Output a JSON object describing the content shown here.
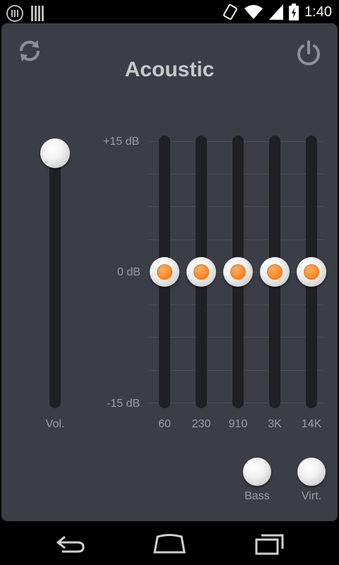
{
  "status_bar": {
    "time": "1:40"
  },
  "header": {
    "title": "Acoustic"
  },
  "equalizer": {
    "db_top": "+15 dB",
    "db_mid": "0 dB",
    "db_bottom": "-15 dB",
    "bands": [
      {
        "label": "60",
        "level_db": 0
      },
      {
        "label": "230",
        "level_db": 0
      },
      {
        "label": "910",
        "level_db": 0
      },
      {
        "label": "3K",
        "level_db": 0
      },
      {
        "label": "14K",
        "level_db": 0
      }
    ]
  },
  "volume": {
    "label": "Vol.",
    "level_fraction": 1.0
  },
  "effects": {
    "bass_label": "Bass",
    "virt_label": "Virt."
  },
  "colors": {
    "panel": "#3b3e47",
    "accent": "#ff8a2a"
  }
}
